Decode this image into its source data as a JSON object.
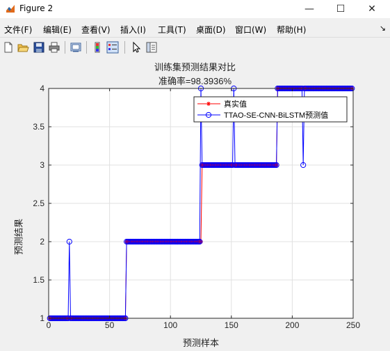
{
  "window": {
    "title": "Figure 2",
    "minimize": "—",
    "maximize": "☐",
    "close": "✕"
  },
  "menu": {
    "items": [
      "文件(F)",
      "编辑(E)",
      "查看(V)",
      "插入(I)",
      "工具(T)",
      "桌面(D)",
      "窗口(W)",
      "帮助(H)"
    ],
    "overflow_arrow": "↘"
  },
  "toolbar": {
    "buttons": [
      "new-figure-icon",
      "open-file-icon",
      "save-icon",
      "print-icon",
      "link-plot-icon",
      "colorbar-icon",
      "legend-icon",
      "pointer-icon",
      "property-inspector-icon"
    ]
  },
  "chart_data": {
    "type": "line",
    "title": "训练集预测结果对比",
    "subtitle": "准确率=98.3936%",
    "xlabel": "预测样本",
    "ylabel": "预测结果",
    "xlim": [
      0,
      250
    ],
    "ylim": [
      1,
      4
    ],
    "xticks": [
      0,
      50,
      100,
      150,
      200,
      250
    ],
    "yticks": [
      1,
      1.5,
      2,
      2.5,
      3,
      3.5,
      4
    ],
    "xtick_labels": [
      "0",
      "50",
      "100",
      "150",
      "200",
      "250"
    ],
    "ytick_labels": [
      "1",
      "1.5",
      "2",
      "2.5",
      "3",
      "3.5",
      "4"
    ],
    "grid": true,
    "legend_position": "top-right",
    "n_samples": 249,
    "series": [
      {
        "name": "真实值",
        "color": "#ff0000",
        "marker": "star",
        "segments": [
          {
            "from": 1,
            "to": 63,
            "value": 1
          },
          {
            "from": 64,
            "to": 125,
            "value": 2
          },
          {
            "from": 126,
            "to": 187,
            "value": 3
          },
          {
            "from": 188,
            "to": 249,
            "value": 4
          }
        ]
      },
      {
        "name": "TTAO-SE-CNN-BiLSTM预测值",
        "color": "#0000ff",
        "marker": "circle",
        "segments": [
          {
            "from": 1,
            "to": 63,
            "value": 1
          },
          {
            "from": 64,
            "to": 124,
            "value": 2
          },
          {
            "from": 125,
            "to": 187,
            "value": 3
          },
          {
            "from": 188,
            "to": 249,
            "value": 4
          }
        ],
        "outliers": [
          {
            "x": 17,
            "y": 2
          },
          {
            "x": 125,
            "y": 4
          },
          {
            "x": 152,
            "y": 4
          },
          {
            "x": 209,
            "y": 3
          }
        ]
      }
    ]
  }
}
